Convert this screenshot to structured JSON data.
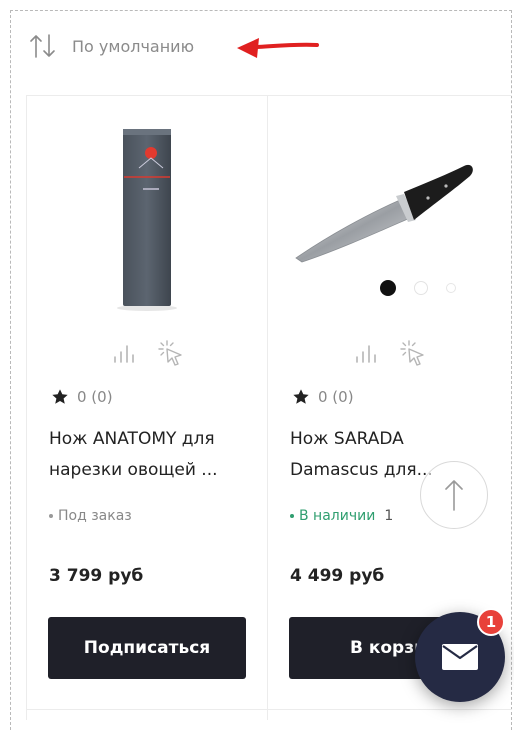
{
  "sort": {
    "label": "По умолчанию"
  },
  "products": [
    {
      "name_line1": "Нож ANATOMY для",
      "name_line2": "нарезки овощей ...",
      "rating": "0 (0)",
      "stock": "Под заказ",
      "quantity": "",
      "price": "3 799 руб",
      "button": "Подписаться"
    },
    {
      "name_line1": "Нож SARADA",
      "name_line2": "Damascus для...",
      "rating": "0 (0)",
      "stock": "В наличии",
      "quantity": "1",
      "price": "4 499 руб",
      "button": "В корзи"
    }
  ],
  "chat": {
    "badge_count": "1"
  },
  "colors": {
    "button_bg": "#1f2029",
    "in_stock": "#2f9e6f",
    "badge": "#e8413a",
    "chat_fab": "#252a44",
    "annotation_arrow": "#e02020"
  },
  "icons": [
    "sort-arrows-icon",
    "compare-icon",
    "quick-view-icon",
    "star-icon",
    "arrow-up-icon",
    "mail-icon"
  ]
}
